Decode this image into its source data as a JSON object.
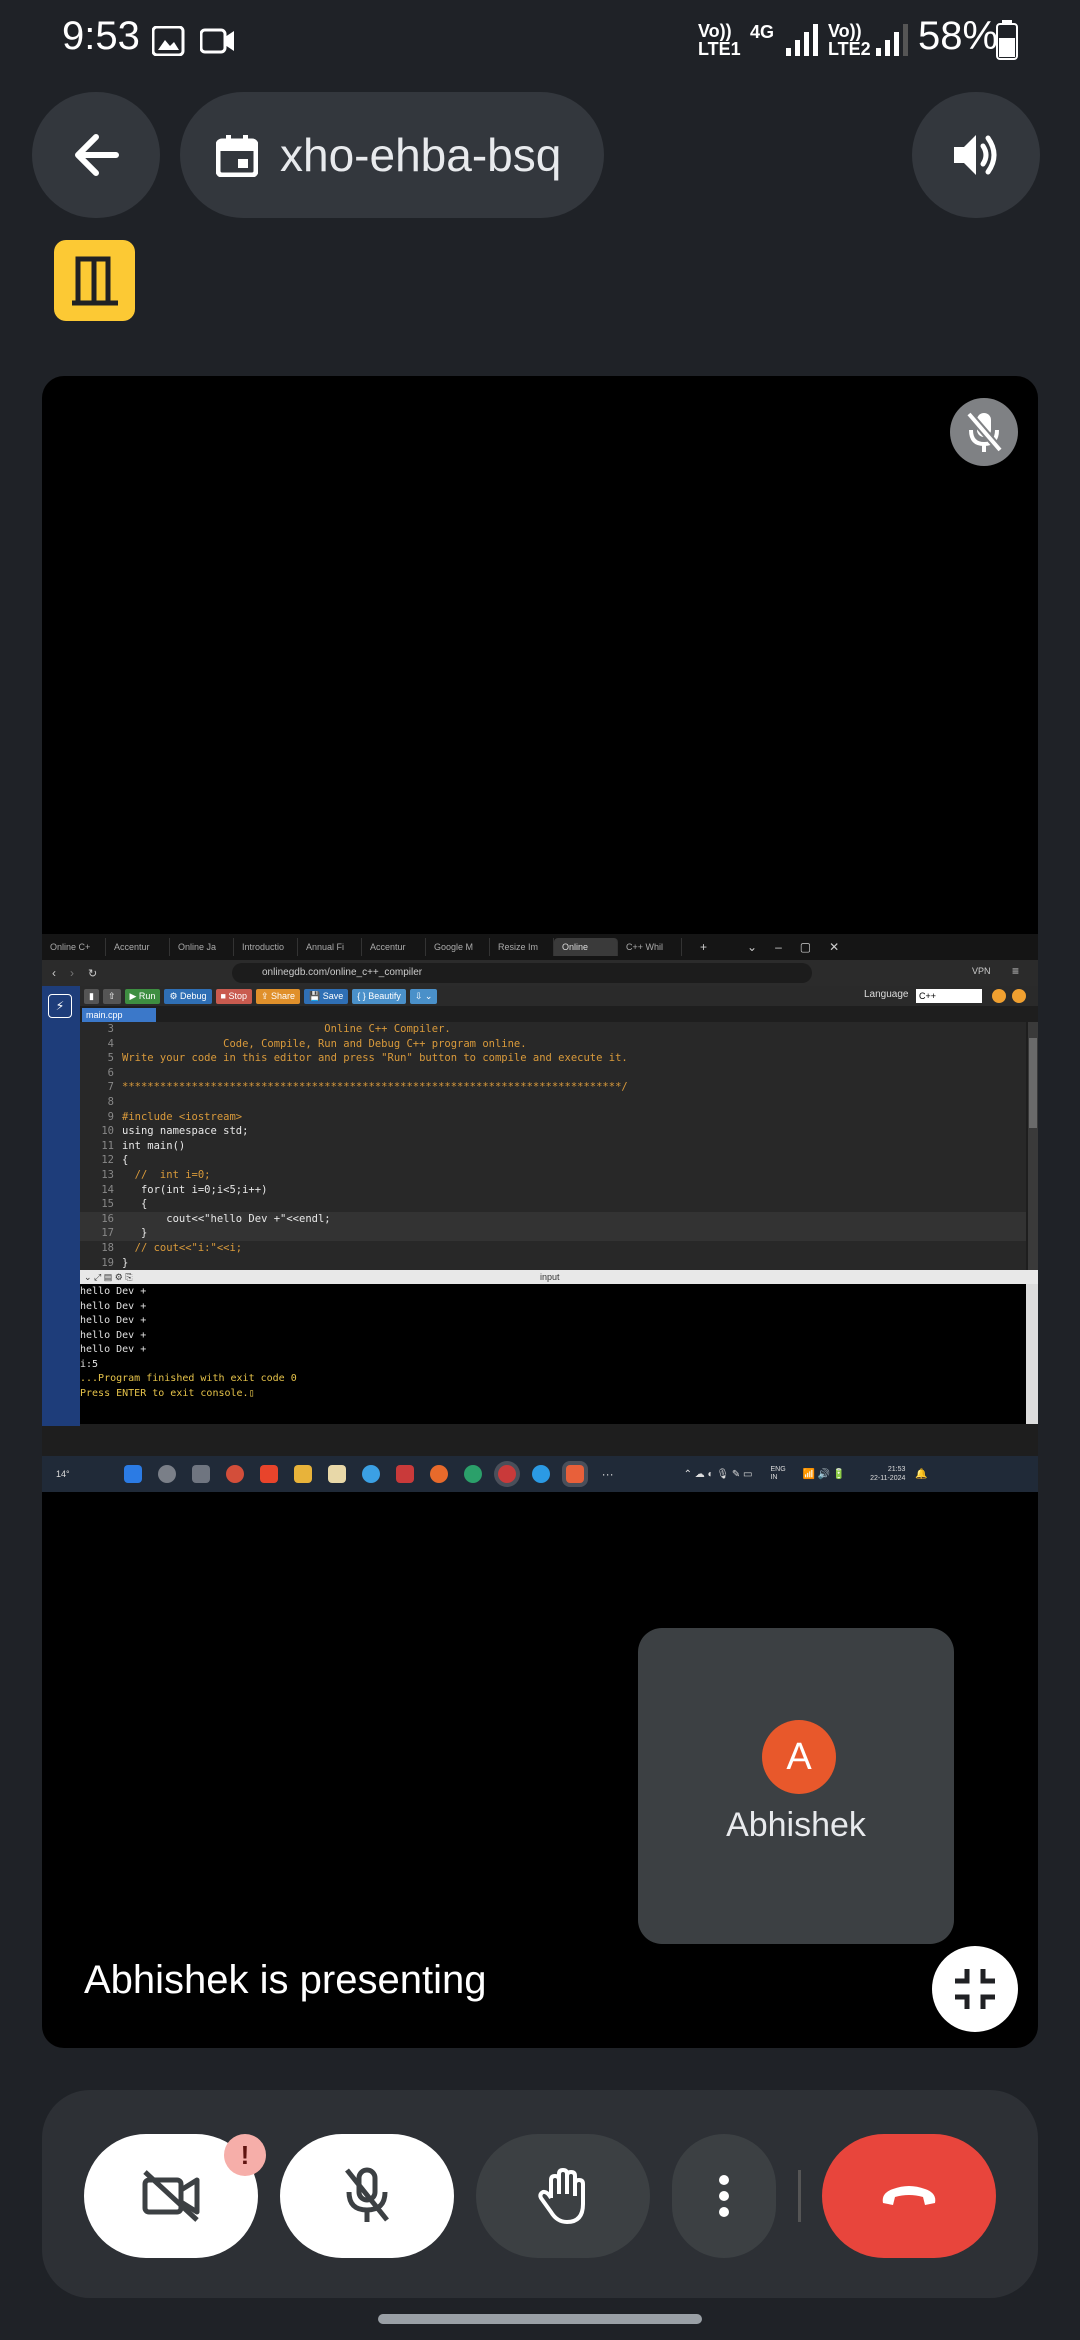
{
  "status": {
    "time": "9:53",
    "network1": "Vo)) LTE1",
    "network_type": "4G",
    "network2": "Vo)) LTE2",
    "battery": "58%"
  },
  "meeting": {
    "code": "xho-ehba-bsq"
  },
  "share": {
    "tabs": [
      "Online C+",
      "Accentur",
      "Online Ja",
      "Introductio",
      "Annual Fi",
      "Accentur",
      "Google M",
      "Resize Im",
      "Online",
      "C++ Whil"
    ],
    "url": "onlinegdb.com/online_c++_compiler",
    "vpn": "VPN",
    "toolbar": {
      "run": "▶ Run",
      "debug": "⚙ Debug",
      "stop": "■ Stop",
      "share": "⇪ Share",
      "save": "💾 Save",
      "beautify": "{ } Beautify"
    },
    "language_label": "Language",
    "language_value": "C++",
    "file_tab": "main.cpp",
    "code": [
      {
        "n": "3",
        "t": "                                Online C++ Compiler.",
        "c": "c-orange"
      },
      {
        "n": "4",
        "t": "                Code, Compile, Run and Debug C++ program online.",
        "c": "c-orange"
      },
      {
        "n": "5",
        "t": "Write your code in this editor and press \"Run\" button to compile and execute it.",
        "c": "c-orange"
      },
      {
        "n": "6",
        "t": "",
        "c": "c-orange"
      },
      {
        "n": "7",
        "t": "*******************************************************************************/",
        "c": "c-orange"
      },
      {
        "n": "8",
        "t": "",
        "c": "c-white"
      },
      {
        "n": "9",
        "t": "#include <iostream>",
        "c": "c-orange"
      },
      {
        "n": "10",
        "t": "using namespace std;",
        "c": "c-white"
      },
      {
        "n": "11",
        "t": "int main()",
        "c": "c-white"
      },
      {
        "n": "12",
        "t": "{",
        "c": "c-white"
      },
      {
        "n": "13",
        "t": "  //  int i=0;",
        "c": "c-orange"
      },
      {
        "n": "14",
        "t": "   for(int i=0;i<5;i++)",
        "c": "c-white"
      },
      {
        "n": "15",
        "t": "   {",
        "c": "c-white"
      },
      {
        "n": "16",
        "t": "       cout<<\"hello Dev +\"<<endl;",
        "c": "c-white"
      },
      {
        "n": "17",
        "t": "   }",
        "c": "c-white"
      },
      {
        "n": "18",
        "t": "  // cout<<\"i:\"<<i;",
        "c": "c-orange"
      },
      {
        "n": "19",
        "t": "}",
        "c": "c-white"
      }
    ],
    "console_label": "input",
    "console": [
      {
        "t": "hello Dev +",
        "c": "#e0e0e0"
      },
      {
        "t": "hello Dev +",
        "c": "#e0e0e0"
      },
      {
        "t": "hello Dev +",
        "c": "#e0e0e0"
      },
      {
        "t": "hello Dev +",
        "c": "#e0e0e0"
      },
      {
        "t": "hello Dev +",
        "c": "#e0e0e0"
      },
      {
        "t": "i:5",
        "c": "#e0e0e0"
      },
      {
        "t": "",
        "c": "#e0e0e0"
      },
      {
        "t": "...Program finished with exit code 0",
        "c": "#e6c34a"
      },
      {
        "t": "Press ENTER to exit console.▯",
        "c": "#e6c34a"
      }
    ],
    "taskbar": {
      "weather": "14°",
      "lang": "ENG",
      "region": "IN",
      "time": "21:53",
      "date": "22-11-2024"
    }
  },
  "participant": {
    "initial": "A",
    "name": "Abhishek"
  },
  "presenting_text": "Abhishek is presenting",
  "controls": {
    "alert": "!"
  },
  "colors": {
    "end_call": "#e8453c",
    "avatar": "#e8582b",
    "exit_badge": "#fcc934"
  }
}
